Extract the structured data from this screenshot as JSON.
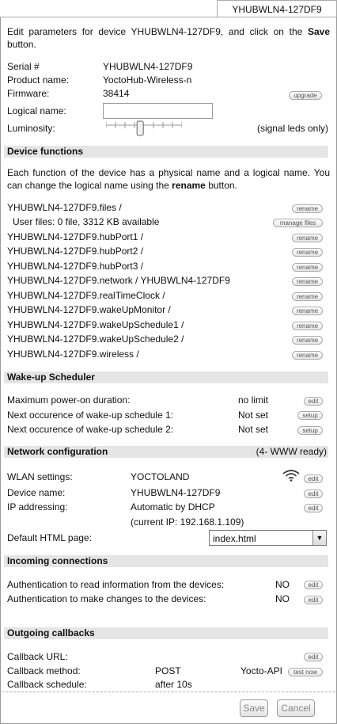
{
  "tab": {
    "title": "YHUBWLN4-127DF9"
  },
  "intro": {
    "prefix": "Edit parameters for device YHUBWLN4-127DF9, and click on the ",
    "bold": "Save",
    "suffix": " button."
  },
  "device": {
    "serial_label": "Serial #",
    "serial_value": "YHUBWLN4-127DF9",
    "product_label": "Product name:",
    "product_value": "YoctoHub-Wireless-n",
    "firmware_label": "Firmware:",
    "firmware_value": "38414",
    "upgrade_button": "upgrade",
    "logical_label": "Logical name:",
    "logical_value": "",
    "luminosity_label": "Luminosity:",
    "luminosity_note": "(signal leds only)",
    "luminosity_level": 0.45
  },
  "functions": {
    "title": "Device functions",
    "desc_prefix": "Each function of the device has a physical name and a logical name. You can change the logical name using the ",
    "desc_bold": "rename",
    "desc_suffix": " button.",
    "rename_label": "rename",
    "manage_label": "manage files",
    "items": [
      "YHUBWLN4-127DF9.files /",
      "User files: 0 file, 3312 KB available",
      "YHUBWLN4-127DF9.hubPort1 /",
      "YHUBWLN4-127DF9.hubPort2 /",
      "YHUBWLN4-127DF9.hubPort3 /",
      "YHUBWLN4-127DF9.network / YHUBWLN4-127DF9",
      "YHUBWLN4-127DF9.realTimeClock /",
      "YHUBWLN4-127DF9.wakeUpMonitor /",
      "YHUBWLN4-127DF9.wakeUpSchedule1 /",
      "YHUBWLN4-127DF9.wakeUpSchedule2 /",
      "YHUBWLN4-127DF9.wireless /"
    ]
  },
  "wakeup": {
    "title": "Wake-up Scheduler",
    "rows": [
      {
        "label": "Maximum power-on duration:",
        "value": "no limit",
        "button": "edit"
      },
      {
        "label": "Next occurence of wake-up schedule 1:",
        "value": "Not set",
        "button": "setup"
      },
      {
        "label": "Next occurence of wake-up schedule 2:",
        "value": "Not set",
        "button": "setup"
      }
    ]
  },
  "network": {
    "title": "Network configuration",
    "status": "(4- WWW ready)",
    "wlan_label": "WLAN settings:",
    "wlan_value": "YOCTOLAND",
    "device_label": "Device name:",
    "device_value": "YHUBWLN4-127DF9",
    "ip_label": "IP addressing:",
    "ip_value": "Automatic by DHCP",
    "ip_current": "(current IP: 192.168.1.109)",
    "html_label": "Default HTML page:",
    "html_value": "index.html",
    "edit_label": "edit"
  },
  "incoming": {
    "title": "Incoming connections",
    "rows": [
      {
        "label": "Authentication to read information from the devices:",
        "value": "NO",
        "button": "edit"
      },
      {
        "label": "Authentication to make changes to the devices:",
        "value": "NO",
        "button": "edit"
      }
    ]
  },
  "outgoing": {
    "title": "Outgoing callbacks",
    "url_label": "Callback URL:",
    "url_button": "edit",
    "method_label": "Callback method:",
    "method_value": "POST",
    "method_type": "Yocto-API",
    "test_button": "test now",
    "schedule_label": "Callback schedule:",
    "schedule_value": "after 10s"
  },
  "footer": {
    "save": "Save",
    "cancel": "Cancel"
  }
}
